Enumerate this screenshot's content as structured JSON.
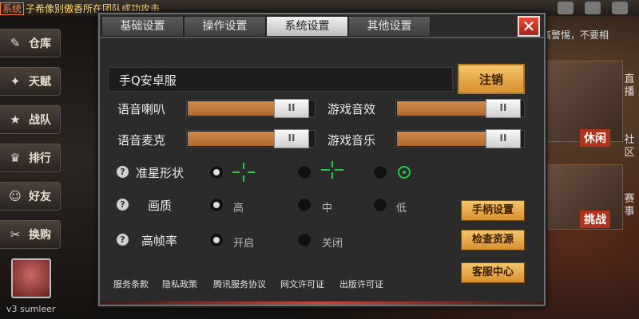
{
  "ticker": {
    "tag": "系统",
    "text": "子希像别傲香所在团队成功攻击"
  },
  "left_nav": [
    {
      "label": "仓库",
      "icon": "warehouse-icon",
      "glyph": "✎"
    },
    {
      "label": "天赋",
      "icon": "talent-icon",
      "glyph": "✦"
    },
    {
      "label": "战队",
      "icon": "team-icon",
      "glyph": "★"
    },
    {
      "label": "排行",
      "icon": "trophy-icon",
      "glyph": "♛"
    },
    {
      "label": "好友",
      "icon": "friends-icon",
      "glyph": "☺"
    },
    {
      "label": "换购",
      "icon": "tools-icon",
      "glyph": "✂"
    }
  ],
  "player": {
    "level_name": "v3 sumleer"
  },
  "right_panel": {
    "tab_live": "直播",
    "tab_community": "社区",
    "tab_event": "赛事",
    "banner_leisure": "休闲",
    "banner_challenge": "挑战",
    "notice": "高警惕，不要相"
  },
  "dialog": {
    "tabs": [
      "基础设置",
      "操作设置",
      "系统设置",
      "其他设置"
    ],
    "active_tab": 2,
    "close_label": "✕",
    "server_name": "手Q安卓服",
    "logout_label": "注销",
    "sliders": {
      "voice_speaker": {
        "label": "语音喇叭",
        "value_percent": 70
      },
      "game_sfx": {
        "label": "游戏音效",
        "value_percent": 72
      },
      "voice_mic": {
        "label": "语音麦克",
        "value_percent": 70
      },
      "game_music": {
        "label": "游戏音乐",
        "value_percent": 72
      }
    },
    "knob_glyph": "II",
    "crosshair": {
      "label": "准星形状",
      "selected": 0
    },
    "quality": {
      "label": "画质",
      "options": [
        "高",
        "中",
        "低"
      ],
      "selected": 0
    },
    "high_fps": {
      "label": "高帧率",
      "options": [
        "开启",
        "关闭"
      ],
      "selected": 0
    },
    "help_glyph": "?",
    "buttons": {
      "controller": "手柄设置",
      "check_resources": "检查资源",
      "customer_service": "客服中心"
    },
    "links": [
      "服务条款",
      "隐私政策",
      "腾讯服务协议",
      "网文许可证",
      "出版许可证"
    ]
  },
  "colors": {
    "accent_orange": "#d8902e",
    "crosshair_green": "#22cc44",
    "close_red": "#c8301e"
  }
}
